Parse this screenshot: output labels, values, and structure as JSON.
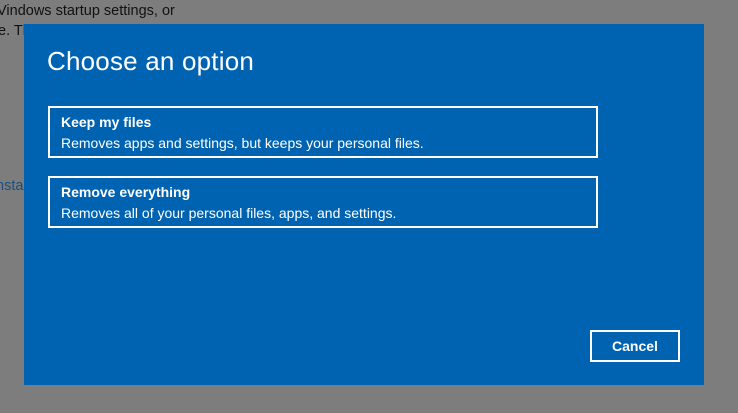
{
  "background": {
    "line1": "Vindows startup settings, or",
    "line2": "e. Th",
    "link": "nsta"
  },
  "dialog": {
    "title": "Choose an option",
    "options": [
      {
        "title": "Keep my files",
        "description": "Removes apps and settings, but keeps your personal files."
      },
      {
        "title": "Remove everything",
        "description": "Removes all of your personal files, apps, and settings."
      }
    ],
    "cancel_label": "Cancel"
  },
  "colors": {
    "dialog_background": "#0063b1",
    "overlay": "#7d7d7d",
    "text": "#ffffff",
    "link": "#1b4f7f"
  }
}
